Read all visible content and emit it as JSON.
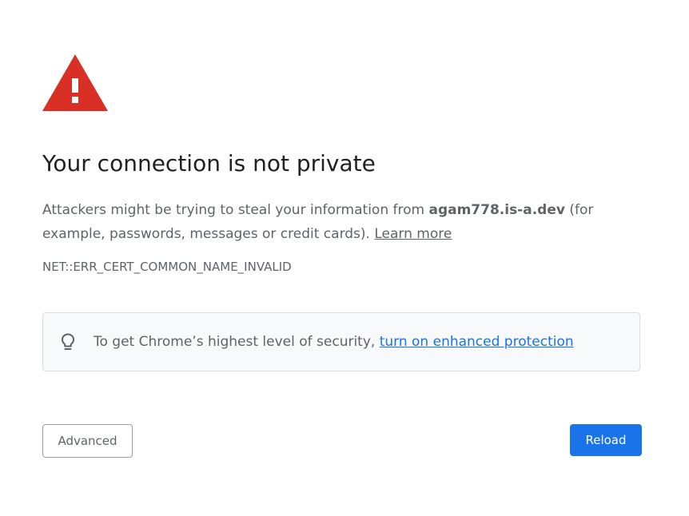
{
  "colors": {
    "warning_red": "#d93025",
    "accent_blue": "#1a73e8",
    "text_secondary": "#5f6368",
    "promo_background": "#f8f9fa"
  },
  "icons": {
    "warning": "warning-triangle-icon",
    "promo": "lightbulb-icon"
  },
  "title": "Your connection is not private",
  "explanation": {
    "prefix": "Attackers might be trying to steal your information from ",
    "host": "agam778.is-a.dev",
    "suffix": " (for example, passwords, messages or credit cards). ",
    "learn_more": "Learn more"
  },
  "error_code": "NET::ERR_CERT_COMMON_NAME_INVALID",
  "promo": {
    "text": "To get Chrome’s highest level of security, ",
    "link": "turn on enhanced protection"
  },
  "buttons": {
    "advanced": "Advanced",
    "reload": "Reload"
  }
}
